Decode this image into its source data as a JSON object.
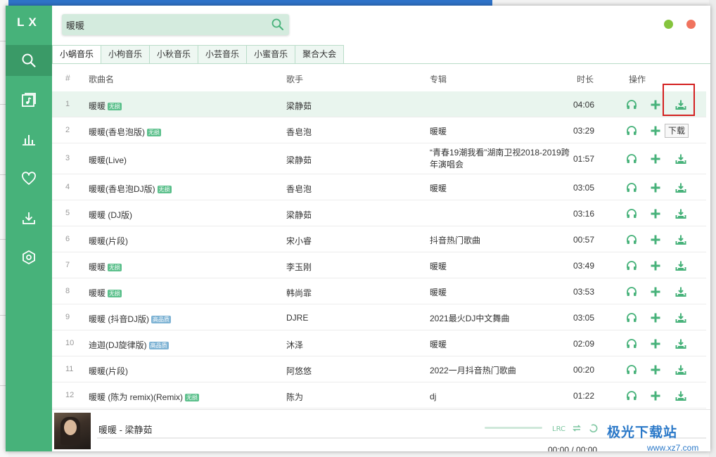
{
  "app": {
    "logo": "LX"
  },
  "search": {
    "value": "暖暖"
  },
  "tabs": [
    "小蜗音乐",
    "小枸音乐",
    "小秋音乐",
    "小芸音乐",
    "小蜜音乐",
    "聚合大会"
  ],
  "headers": {
    "num": "#",
    "name": "歌曲名",
    "singer": "歌手",
    "album": "专辑",
    "duration": "时长",
    "actions": "操作"
  },
  "rows": [
    {
      "num": "1",
      "name": "暖暖",
      "badge": "无损",
      "singer": "梁静茹",
      "album": "",
      "duration": "04:06"
    },
    {
      "num": "2",
      "name": "暖暖(香皂泡版)",
      "badge": "无损",
      "singer": "香皂泡",
      "album": "暖暖",
      "duration": "03:29"
    },
    {
      "num": "3",
      "name": "暖暖(Live)",
      "badge": "",
      "singer": "梁静茹",
      "album": "“青春19潮我看”湖南卫视2018-2019跨年演唱会",
      "duration": "01:57"
    },
    {
      "num": "4",
      "name": "暖暖(香皂泡DJ版)",
      "badge": "无损",
      "singer": "香皂泡",
      "album": "暖暖",
      "duration": "03:05"
    },
    {
      "num": "5",
      "name": "暖暖 (DJ版)",
      "badge": "",
      "singer": "梁静茹",
      "album": "",
      "duration": "03:16"
    },
    {
      "num": "6",
      "name": "暖暖(片段)",
      "badge": "",
      "singer": "宋小睿",
      "album": "抖音热门歌曲",
      "duration": "00:57"
    },
    {
      "num": "7",
      "name": "暖暖",
      "badge": "无损",
      "singer": "李玉刚",
      "album": "暖暖",
      "duration": "03:49"
    },
    {
      "num": "8",
      "name": "暖暖",
      "badge": "无损",
      "singer": "韩尚霏",
      "album": "暖暖",
      "duration": "03:53"
    },
    {
      "num": "9",
      "name": "暖暖 (抖音DJ版)",
      "badge": "高品质",
      "singer": "DJRE",
      "album": "2021最火DJ中文舞曲",
      "duration": "03:05"
    },
    {
      "num": "10",
      "name": "迪迦(DJ旋律版)",
      "badge": "高品质",
      "singer": "沐泽",
      "album": "暖暖",
      "duration": "02:09"
    },
    {
      "num": "11",
      "name": "暖暖(片段)",
      "badge": "",
      "singer": "阿悠悠",
      "album": "2022一月抖音热门歌曲",
      "duration": "00:20"
    },
    {
      "num": "12",
      "name": "暖暖 (陈为 remix)(Remix)",
      "badge": "无损",
      "singer": "陈为",
      "album": "dj",
      "duration": "01:22"
    }
  ],
  "tooltip": "下载",
  "player": {
    "title": "暖暖 - 梁静茹",
    "time": "00:00 / 00:00"
  },
  "watermark": {
    "text": "极光下载站",
    "url": "www.xz7.com"
  },
  "colors": {
    "accent": "#47b27a",
    "badge_lossless": "#5cc08c",
    "badge_hq": "#7eb3d4",
    "min_btn": "#85c43d",
    "close_btn": "#f0735e"
  }
}
